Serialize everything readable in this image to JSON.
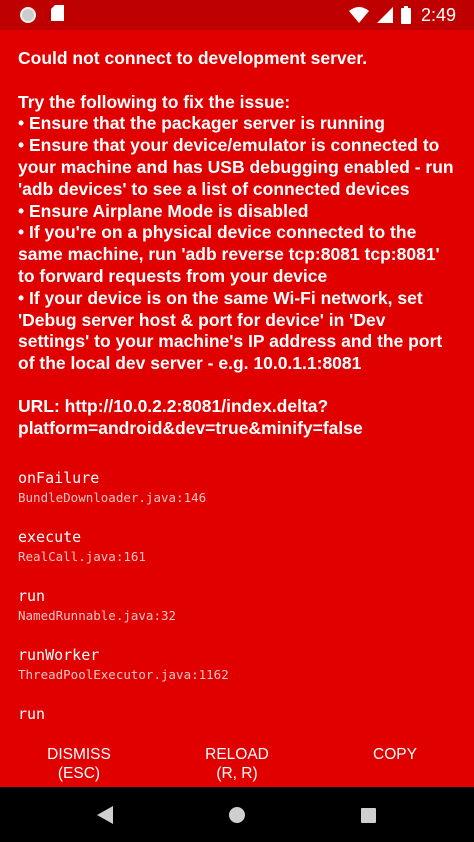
{
  "status_bar": {
    "time": "2:49",
    "icons": [
      "circle-notification-icon",
      "sd-card-icon",
      "wifi-icon",
      "signal-icon",
      "battery-icon"
    ]
  },
  "error": {
    "message": "Could not connect to development server.\n\nTry the following to fix the issue:\n• Ensure that the packager server is running\n• Ensure that your device/emulator is connected to your machine and has USB debugging enabled - run 'adb devices' to see a list of connected devices\n• Ensure Airplane Mode is disabled\n• If you're on a physical device connected to the same machine, run 'adb reverse tcp:8081 tcp:8081' to forward requests from your device\n• If your device is on the same Wi-Fi network, set 'Debug server host & port for device' in 'Dev settings' to your machine's IP address and the port of the local dev server - e.g. 10.0.1.1:8081",
    "url": "URL: http://10.0.2.2:8081/index.delta?platform=android&dev=true&minify=false"
  },
  "stack_trace": [
    {
      "method": "onFailure",
      "file": "BundleDownloader.java:146"
    },
    {
      "method": "execute",
      "file": "RealCall.java:161"
    },
    {
      "method": "run",
      "file": "NamedRunnable.java:32"
    },
    {
      "method": "runWorker",
      "file": "ThreadPoolExecutor.java:1162"
    },
    {
      "method": "run",
      "file": ""
    }
  ],
  "actions": {
    "dismiss": {
      "label": "DISMISS",
      "shortcut": "(ESC)"
    },
    "reload": {
      "label": "RELOAD",
      "shortcut": "(R, R)"
    },
    "copy": {
      "label": "COPY"
    }
  },
  "colors": {
    "background": "#e00000",
    "status_bar": "#bf0000",
    "text": "#ffffff",
    "file_text": "#f2c4c4",
    "nav_bar": "#000000"
  },
  "nav_bar": {
    "icons": [
      "back-icon",
      "home-icon",
      "recents-icon"
    ]
  }
}
